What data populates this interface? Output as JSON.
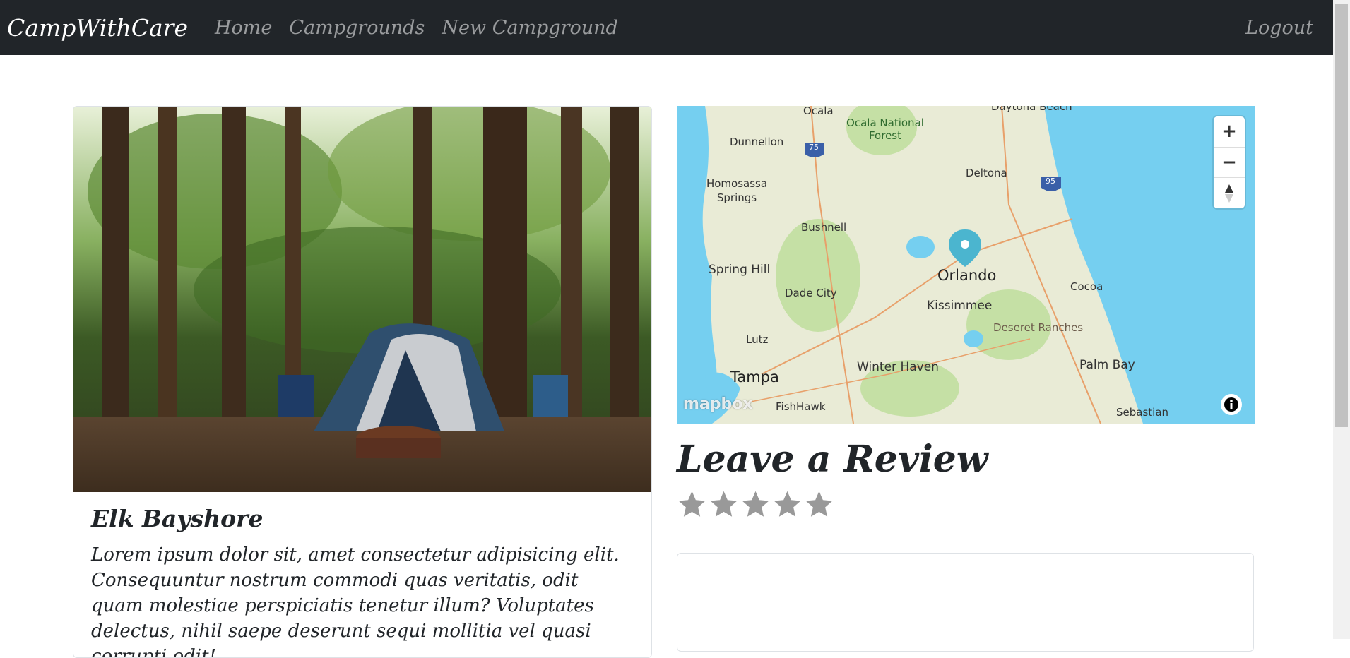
{
  "navbar": {
    "brand": "CampWithCare",
    "links": [
      "Home",
      "Campgrounds",
      "New Campground"
    ],
    "logout": "Logout"
  },
  "campground": {
    "title": "Elk Bayshore",
    "description": "Lorem ipsum dolor sit, amet consectetur adipisicing elit. Consequuntur nostrum commodi quas veritatis, odit quam molestiae perspiciatis tenetur illum? Voluptates delectus, nihil saepe deserunt sequi mollitia vel quasi corrupti odit!"
  },
  "map": {
    "places": {
      "ocala": "Ocala",
      "ocala_forest": "Ocala National Forest",
      "daytona": "Daytona Beach",
      "dunnellon": "Dunnellon",
      "deltona": "Deltona",
      "homosassa": "Homosassa Springs",
      "bushnell": "Bushnell",
      "spring_hill": "Spring Hill",
      "orlando": "Orlando",
      "cocoa": "Cocoa",
      "dade_city": "Dade City",
      "kissimmee": "Kissimmee",
      "deseret": "Deseret Ranches",
      "lutz": "Lutz",
      "tampa": "Tampa",
      "winter_haven": "Winter Haven",
      "palm_bay": "Palm Bay",
      "fishhawk": "FishHawk",
      "sebastian": "Sebastian"
    },
    "highways": {
      "i75": "75",
      "i95": "95"
    },
    "zoom_in": "+",
    "zoom_out": "−",
    "logo": "mapbox",
    "colors": {
      "water": "#75cff0",
      "land": "#e9ebd6",
      "park": "#c5e0a5",
      "marker": "#4bb5cf"
    }
  },
  "review": {
    "title": "Leave a Review",
    "rating_max": 5,
    "textarea_value": ""
  }
}
